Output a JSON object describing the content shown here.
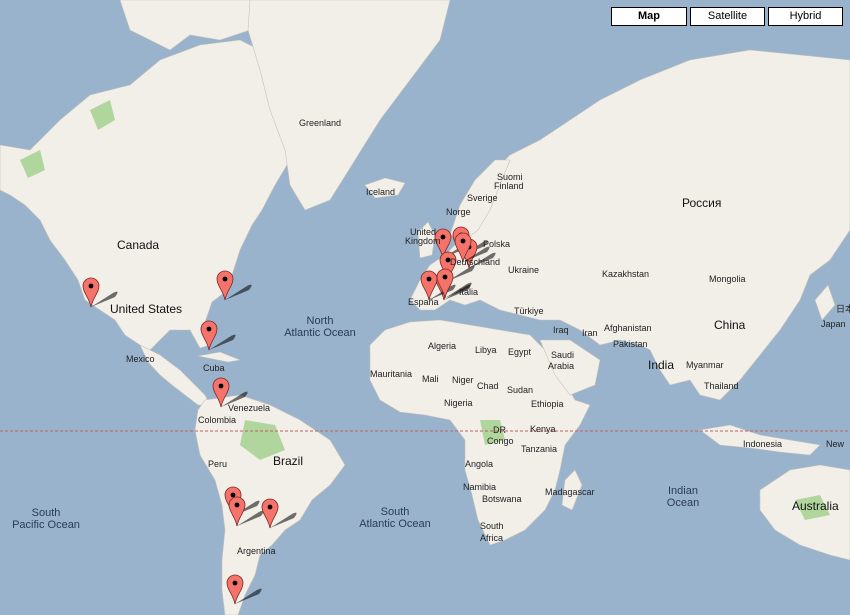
{
  "map_controls": {
    "types": [
      {
        "label": "Map",
        "active": true
      },
      {
        "label": "Satellite",
        "active": false
      },
      {
        "label": "Hybrid",
        "active": false
      }
    ]
  },
  "labels": {
    "greenland": "Greenland",
    "canada": "Canada",
    "united_states": "United States",
    "mexico": "Mexico",
    "cuba": "Cuba",
    "colombia": "Colombia",
    "venezuela": "Venezuela",
    "peru": "Peru",
    "brazil": "Brazil",
    "argentina": "Argentina",
    "iceland": "Iceland",
    "suomi": "Suomi",
    "finland": "Finland",
    "sverige": "Sverige",
    "norge": "Norge",
    "united_kingdom_1": "United",
    "united_kingdom_2": "Kingdom",
    "polska": "Polska",
    "deutschland": "Deutschland",
    "espana": "España",
    "italia": "Italia",
    "ukraine": "Ukraine",
    "turkiye": "Türkiye",
    "rossiya": "Россия",
    "kazakhstan": "Kazakhstan",
    "mongolia": "Mongolia",
    "china": "China",
    "iraq": "Iraq",
    "iran": "Iran",
    "afghanistan": "Afghanistan",
    "pakistan": "Pakistan",
    "india": "India",
    "myanmar": "Myanmar",
    "thailand": "Thailand",
    "saudi_1": "Saudi",
    "saudi_2": "Arabia",
    "egypt": "Egypt",
    "libya": "Libya",
    "algeria": "Algeria",
    "mauritania": "Mauritania",
    "mali": "Mali",
    "niger": "Niger",
    "chad": "Chad",
    "sudan": "Sudan",
    "ethiopia": "Ethiopia",
    "nigeria": "Nigeria",
    "kenya": "Kenya",
    "dr_congo_1": "DR",
    "dr_congo_2": "Congo",
    "tanzania": "Tanzania",
    "angola": "Angola",
    "namibia": "Namibia",
    "botswana": "Botswana",
    "madagascar": "Madagascar",
    "south_africa_1": "South",
    "south_africa_2": "Africa",
    "indonesia": "Indonesia",
    "australia": "Australia",
    "japan": "Japan",
    "japan_kanji": "日本",
    "new_zealand_partial": "New",
    "north_atlantic_1": "North",
    "north_atlantic_2": "Atlantic Ocean",
    "south_atlantic_1": "South",
    "south_atlantic_2": "Atlantic Ocean",
    "south_pacific_1": "South",
    "south_pacific_2": "Pacific Ocean",
    "indian_ocean_1": "Indian",
    "indian_ocean_2": "Ocean"
  },
  "colors": {
    "water": "#99b3cc",
    "land": "#f2efe9",
    "forest": "#9fd08a",
    "border": "#9a8fa8",
    "marker": "#f5736a",
    "equator": "#c06060"
  },
  "markers": [
    {
      "name": "marker-california"
    },
    {
      "name": "marker-new-york"
    },
    {
      "name": "marker-florida"
    },
    {
      "name": "marker-panama"
    },
    {
      "name": "marker-chile-1"
    },
    {
      "name": "marker-chile-2"
    },
    {
      "name": "marker-buenos-aires"
    },
    {
      "name": "marker-patagonia"
    },
    {
      "name": "marker-uk"
    },
    {
      "name": "marker-belgium"
    },
    {
      "name": "marker-germany-1"
    },
    {
      "name": "marker-germany-2"
    },
    {
      "name": "marker-germany-3"
    },
    {
      "name": "marker-france"
    },
    {
      "name": "marker-spain"
    },
    {
      "name": "marker-italy"
    }
  ]
}
